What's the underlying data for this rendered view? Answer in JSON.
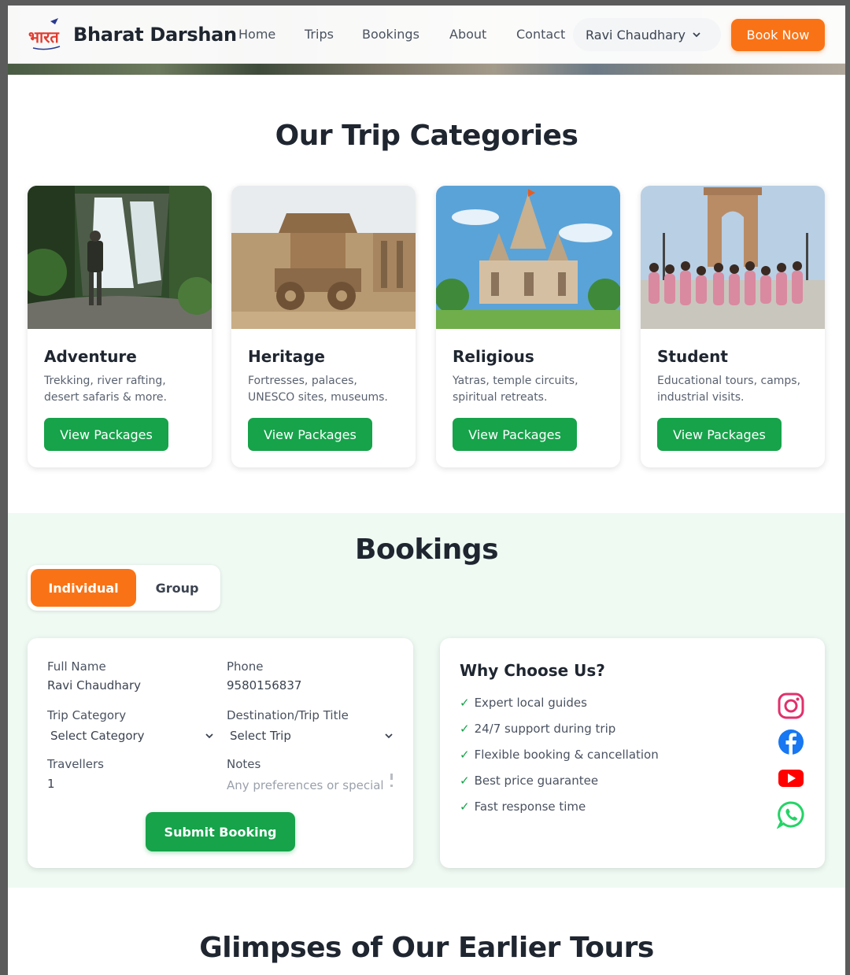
{
  "header": {
    "logo_text": "भारत",
    "brand": "Bharat Darshan",
    "nav": [
      "Home",
      "Trips",
      "Bookings",
      "About",
      "Contact"
    ],
    "user_name": "Ravi Chaudhary",
    "cta": "Book Now"
  },
  "categories": {
    "title": "Our Trip Categories",
    "items": [
      {
        "title": "Adventure",
        "desc": "Trekking, river rafting, desert safaris & more.",
        "button": "View Packages"
      },
      {
        "title": "Heritage",
        "desc": "Fortresses, palaces, UNESCO sites, museums.",
        "button": "View Packages"
      },
      {
        "title": "Religious",
        "desc": "Yatras, temple circuits, spiritual retreats.",
        "button": "View Packages"
      },
      {
        "title": "Student",
        "desc": "Educational tours, camps, industrial visits.",
        "button": "View Packages"
      }
    ]
  },
  "bookings": {
    "title": "Bookings",
    "tabs": [
      "Individual",
      "Group"
    ],
    "form": {
      "full_name_label": "Full Name",
      "full_name_value": "Ravi Chaudhary",
      "phone_label": "Phone",
      "phone_value": "9580156837",
      "category_label": "Trip Category",
      "category_value": "Select Category",
      "destination_label": "Destination/Trip Title",
      "destination_value": "Select Trip",
      "travellers_label": "Travellers",
      "travellers_value": "1",
      "notes_label": "Notes",
      "notes_placeholder": "Any preferences or special",
      "submit": "Submit Booking"
    },
    "why": {
      "title": "Why Choose Us?",
      "items": [
        "Expert local guides",
        "24/7 support during trip",
        "Flexible booking & cancellation",
        "Best price guarantee",
        "Fast response time"
      ]
    },
    "social": [
      "instagram-icon",
      "facebook-icon",
      "youtube-icon",
      "whatsapp-icon"
    ]
  },
  "glimpses": {
    "title": "Glimpses of Our Earlier Tours"
  },
  "colors": {
    "accent_orange": "#f97316",
    "accent_green": "#16a34a",
    "bookings_bg": "#effaf3"
  }
}
